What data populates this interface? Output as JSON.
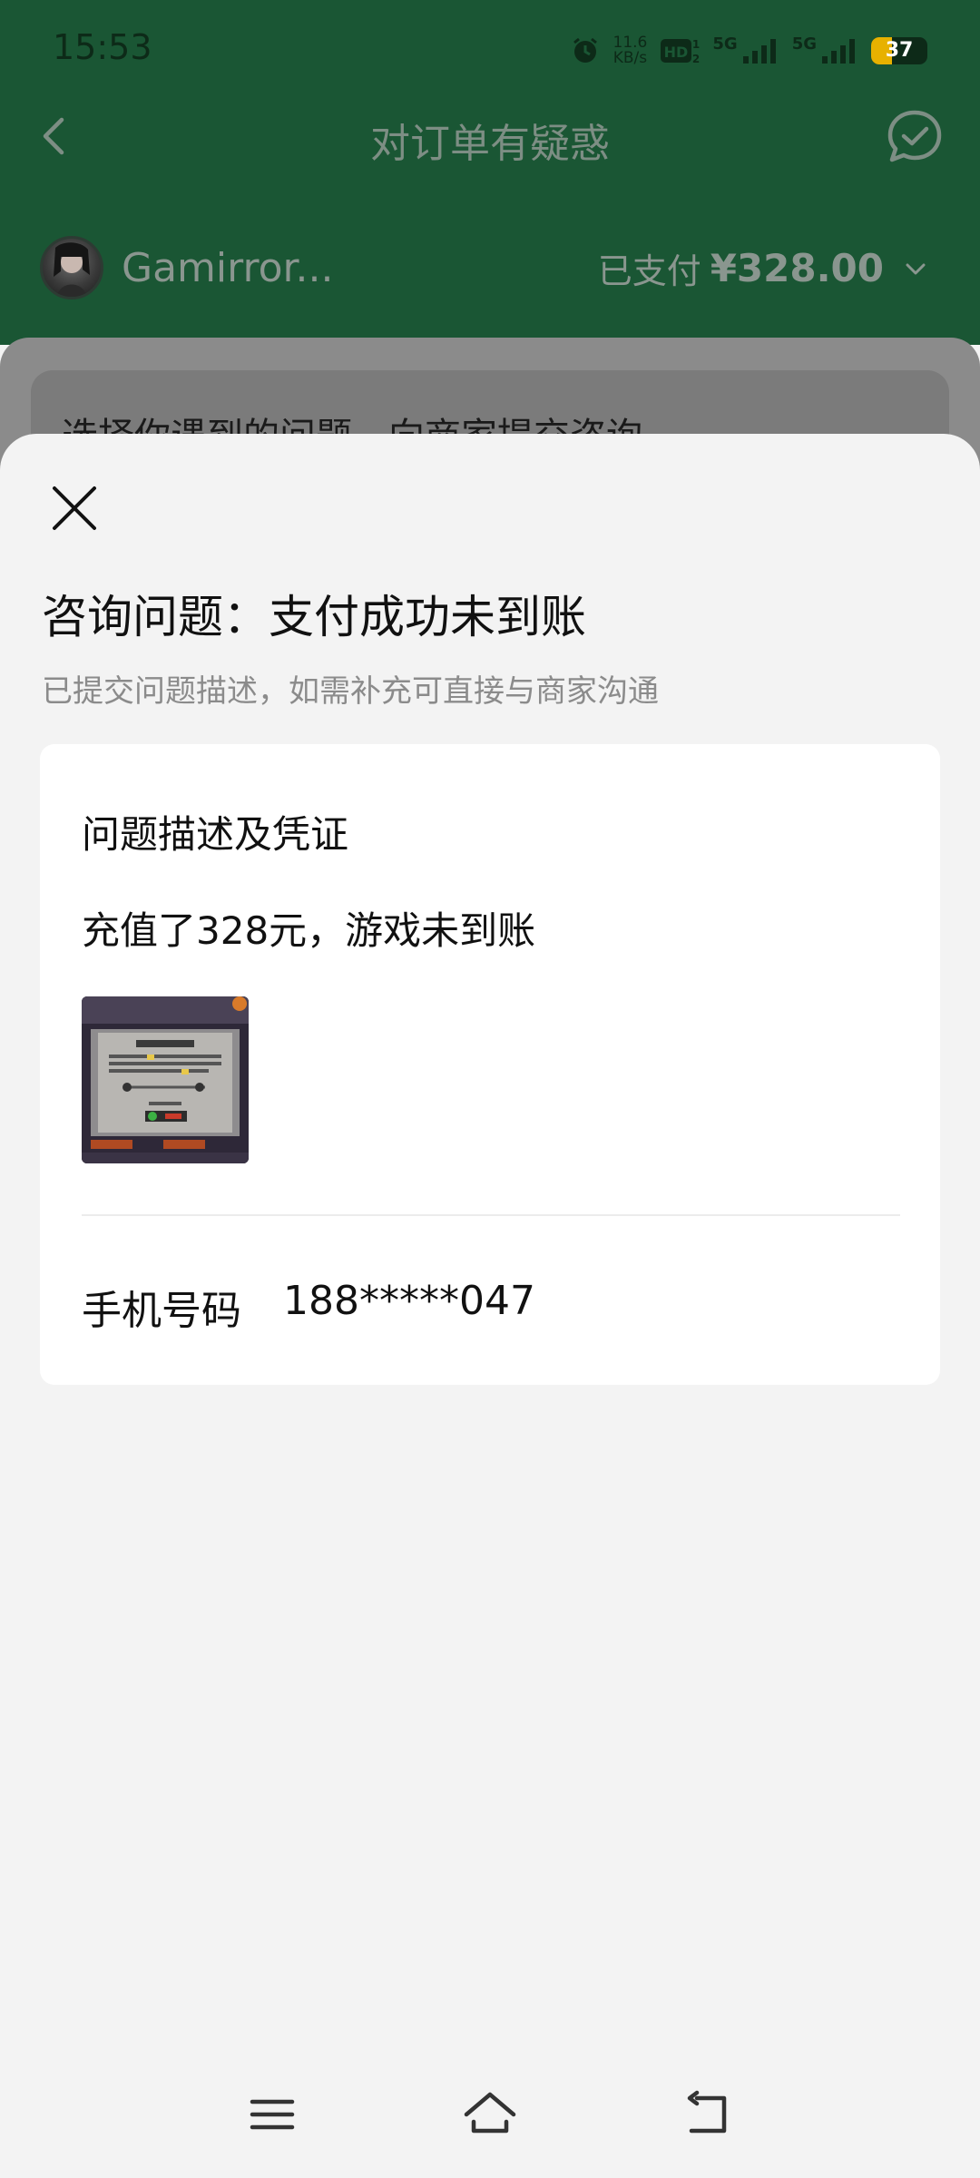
{
  "status_bar": {
    "time": "15:53",
    "net_speed_value": "11.6",
    "net_speed_unit": "KB/s",
    "hd_label": "HD",
    "sim1_label": "5G",
    "sim2_label": "5G",
    "battery": "37",
    "battery_level": 0.37
  },
  "background_page": {
    "nav_title": "对订单有疑惑",
    "merchant_name": "Gamirror...",
    "paid_label": "已支付",
    "paid_amount": "¥328.00",
    "card_text": "选择你遇到的问题，向商家提交咨询"
  },
  "sheet": {
    "title": "咨询问题：支付成功未到账",
    "subtitle": "已提交问题描述，如需补充可直接与商家沟通",
    "card": {
      "heading": "问题描述及凭证",
      "description": "充值了328元，游戏未到账",
      "phone_label": "手机号码",
      "phone_value": "188*****047"
    }
  },
  "icons": {
    "back": "back-arrow-icon",
    "chat": "chat-bubble-check-icon",
    "close": "close-icon",
    "dropdown": "chevron-down-icon",
    "menu": "menu-icon",
    "home": "home-icon",
    "system_back": "system-back-icon"
  },
  "colors": {
    "header_green": "#1a5634",
    "sheet_background": "#f3f3f3",
    "card_background": "#ffffff",
    "battery_fill": "#e7b100"
  }
}
